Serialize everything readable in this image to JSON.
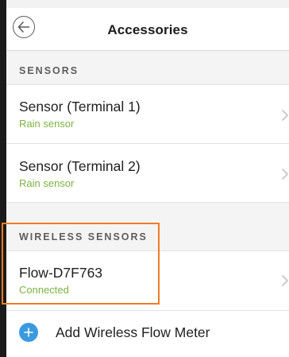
{
  "header": {
    "title": "Accessories",
    "back_icon": "back-arrow-icon"
  },
  "sections": {
    "sensors": {
      "label": "SENSORS",
      "items": [
        {
          "title": "Sensor (Terminal 1)",
          "subtitle": "Rain sensor"
        },
        {
          "title": "Sensor (Terminal 2)",
          "subtitle": "Rain sensor"
        }
      ]
    },
    "wireless": {
      "label": "WIRELESS SENSORS",
      "items": [
        {
          "title": "Flow-D7F763",
          "subtitle": "Connected"
        }
      ]
    }
  },
  "add_action": {
    "label": "Add Wireless Flow Meter",
    "icon": "plus-circle-icon"
  },
  "colors": {
    "accent_green": "#7cb342",
    "accent_blue": "#3b99e0",
    "highlight_orange": "#f07c24"
  }
}
